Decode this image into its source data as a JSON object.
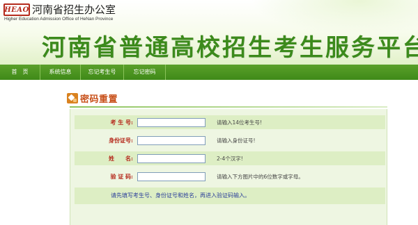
{
  "header": {
    "logo_text": "HEAO",
    "office_name_cn": "河南省招生办公室",
    "office_name_en": "Higher Education Admission Office of HeNan Province",
    "main_title": "河南省普通高校招生考生服务平台"
  },
  "nav": {
    "items": [
      {
        "label": "首　页"
      },
      {
        "label": "系统信息"
      },
      {
        "label": "忘记考生号"
      },
      {
        "label": "忘记密码"
      }
    ]
  },
  "section": {
    "title": "密码重置",
    "icon": "reset-icon"
  },
  "form": {
    "fields": [
      {
        "label": "考 生 号:",
        "value": "",
        "hint": "请输入14位考生号!"
      },
      {
        "label": "身份证号:",
        "value": "",
        "hint": "请输入身份证号!"
      },
      {
        "label": "姓　　名:",
        "value": "",
        "hint": "2-4个汉字!"
      },
      {
        "label": "验 证 码:",
        "value": "",
        "hint": "请输入下方图片中的6位数字或字母。"
      }
    ],
    "notice": "请先填写考生号、身份证号和姓名，再进入验证码输入。"
  },
  "colors": {
    "title_green": "#3c8a1c",
    "nav_green": "#4a9420",
    "label_red": "#b5281b",
    "notice_blue": "#2b3f9a",
    "section_orange": "#c8501a"
  }
}
